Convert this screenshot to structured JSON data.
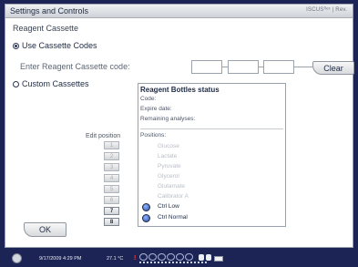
{
  "window": {
    "title": "Settings and Controls",
    "brand": "ISCUSᶠˡᵉˣ | Rev."
  },
  "reagent": {
    "section_title": "Reagent Cassette",
    "use_codes_label": "Use Cassette Codes",
    "use_codes_selected": true,
    "enter_code_label": "Enter Reagent Cassette code:",
    "code_fields": [
      "",
      "",
      ""
    ],
    "clear_label": "Clear",
    "custom_label": "Custom Cassettes",
    "custom_selected": false
  },
  "status": {
    "title": "Reagent Bottles status",
    "code_label": "Code:",
    "expire_label": "Expire date:",
    "remaining_label": "Remaining analyses:",
    "positions_label": "Positions:",
    "positions": [
      {
        "name": "Glucose",
        "active": false
      },
      {
        "name": "Lactate",
        "active": false
      },
      {
        "name": "Pyruvate",
        "active": false
      },
      {
        "name": "Glycerol",
        "active": false
      },
      {
        "name": "Glutamate",
        "active": false
      },
      {
        "name": "Calibrator A",
        "active": false
      },
      {
        "name": "Ctrl Low",
        "active": true
      },
      {
        "name": "Ctrl Normal",
        "active": true
      }
    ]
  },
  "edit": {
    "label": "Edit position",
    "buttons": [
      "1",
      "2",
      "3",
      "4",
      "5",
      "6",
      "7",
      "8"
    ],
    "enabled": [
      false,
      false,
      false,
      false,
      false,
      false,
      true,
      true
    ]
  },
  "ok_label": "OK",
  "taskbar": {
    "datetime": "9/17/2009 4:29 PM",
    "temperature": "27.1 °C",
    "warning": "!"
  },
  "colors": {
    "taskbar": "#1c2456",
    "text": "#1d2a44",
    "disabled": "#b9bec5"
  }
}
